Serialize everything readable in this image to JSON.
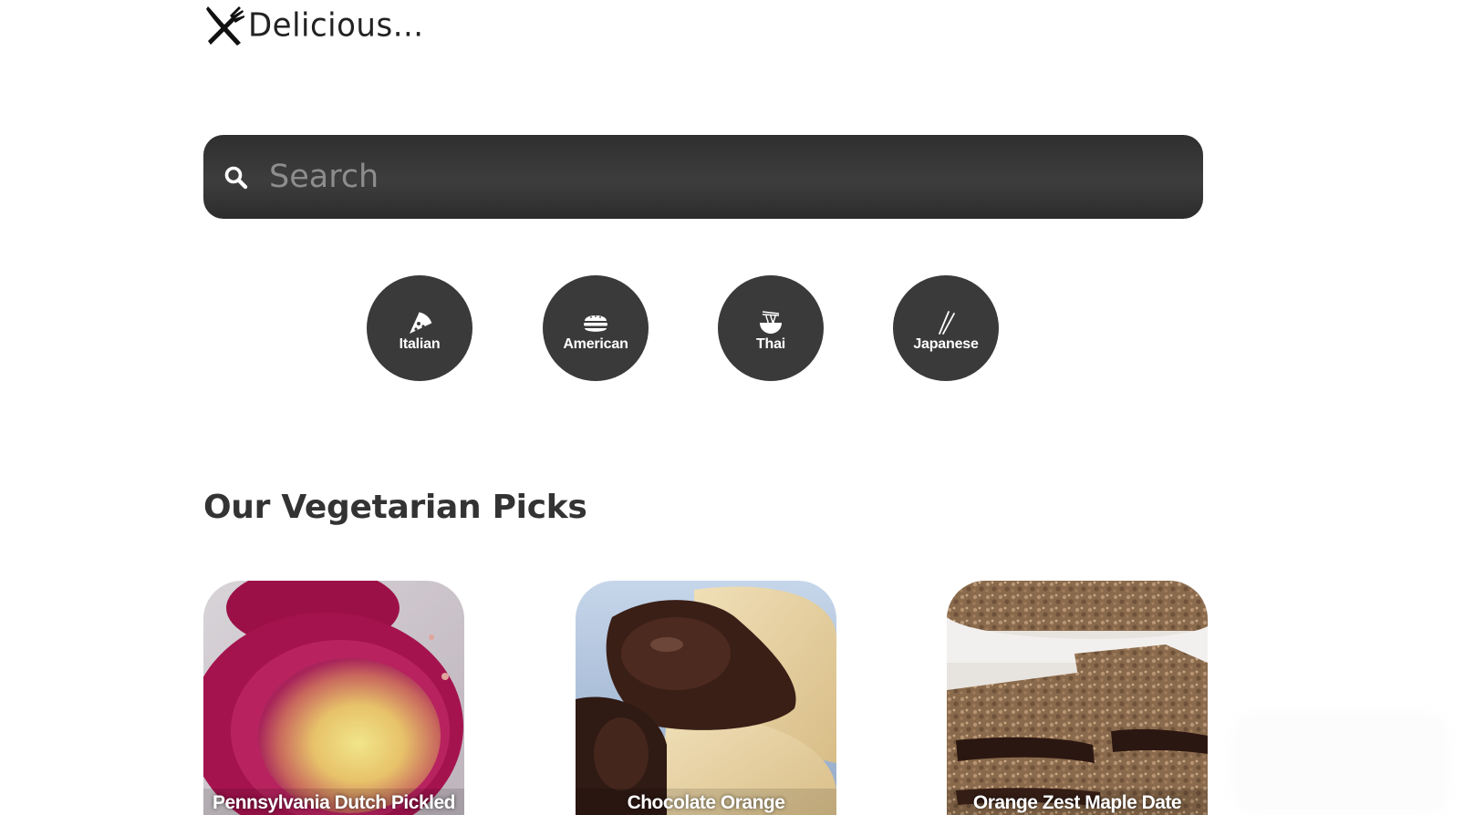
{
  "logo": {
    "text": "Delicious...",
    "icon": "fork-knife-icon"
  },
  "search": {
    "placeholder": "Search",
    "value": "",
    "icon": "search-icon"
  },
  "categories": [
    {
      "label": "Italian",
      "icon": "pizza-icon"
    },
    {
      "label": "American",
      "icon": "burger-icon"
    },
    {
      "label": "Thai",
      "icon": "noodle-bowl-icon"
    },
    {
      "label": "Japanese",
      "icon": "chopsticks-icon"
    }
  ],
  "section": {
    "title": "Our Vegetarian Picks"
  },
  "cards": [
    {
      "title": "Pennsylvania Dutch Pickled"
    },
    {
      "title": "Chocolate Orange"
    },
    {
      "title": "Orange Zest Maple Date"
    }
  ],
  "colors": {
    "dark": "#3a3a3a",
    "text": "#333333",
    "placeholder": "#8d8d8d"
  }
}
